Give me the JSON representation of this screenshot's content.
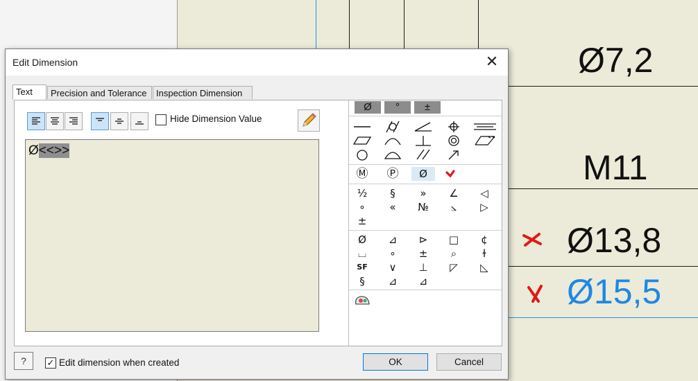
{
  "drawing": {
    "dimensions": [
      {
        "text": "Ø7,2"
      },
      {
        "text": "M11"
      },
      {
        "text": "Ø13,8"
      },
      {
        "text": "Ø15,5"
      }
    ]
  },
  "dialog": {
    "title": "Edit Dimension",
    "close_glyph": "✕",
    "tabs": [
      {
        "label": "Text",
        "active": true
      },
      {
        "label": "Precision and Tolerance",
        "active": false
      },
      {
        "label": "Inspection Dimension",
        "active": false
      }
    ],
    "toolbar": {
      "hide_dimension_label": "Hide Dimension Value",
      "hide_dimension_checked": false
    },
    "editor": {
      "prefix": "Ø",
      "selected_token": "<<>>"
    },
    "symbols": {
      "tabs": [
        "Ø",
        "°",
        "±"
      ],
      "row_set_2": [
        "Ⓜ",
        "Ⓟ",
        "Ø"
      ],
      "row_set_3_text": [
        "⅟₂",
        "§",
        "»",
        "∠",
        "◁",
        "∘",
        "«",
        "№",
        "⦣",
        "▷",
        "±"
      ],
      "row_set_4_text": [
        "Ø",
        "⊿",
        "⊳",
        "□",
        "¢",
        "⌴",
        "∘",
        "±",
        "⌕",
        "ɫ",
        "SF",
        "∨",
        "⊥",
        "◸",
        "◺",
        "§",
        "⊿",
        "⊿"
      ]
    },
    "bottom": {
      "help_glyph": "?",
      "edit_when_created_label": "Edit dimension when created",
      "edit_when_created_checked": true,
      "ok_label": "OK",
      "cancel_label": "Cancel"
    }
  },
  "colors": {
    "sheet": "#ecebd9",
    "accent_blue": "#1e88e5",
    "annotation_red": "#e01818"
  }
}
